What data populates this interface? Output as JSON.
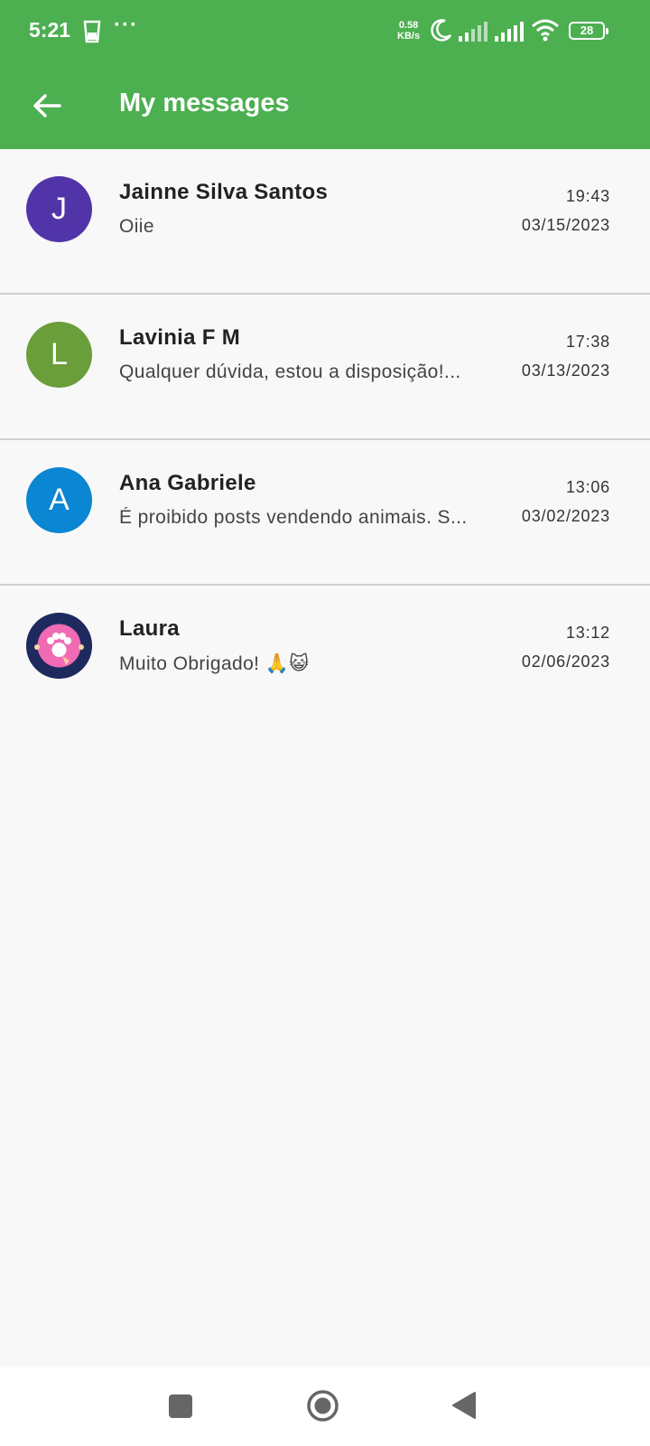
{
  "status_bar": {
    "time": "5:21",
    "more": "···",
    "speed_value": "0.58",
    "speed_unit": "KB/s",
    "battery": "28",
    "icons": [
      "cup-icon",
      "moon-icon",
      "signal-icon",
      "signal-icon",
      "wifi-icon",
      "battery-icon"
    ]
  },
  "app_bar": {
    "title": "My messages",
    "back_icon": "arrow-left-icon",
    "color": "#4caf50"
  },
  "messages": [
    {
      "initial": "J",
      "avatar_color": "#5135a8",
      "name": "Jainne Silva Santos",
      "preview": "Oiie",
      "time": "19:43",
      "date": "03/15/2023"
    },
    {
      "initial": "L",
      "avatar_color": "#6a9e3a",
      "name": "Lavinia F M",
      "preview": "Qualquer dúvida, estou a disposição!...",
      "time": "17:38",
      "date": "03/13/2023"
    },
    {
      "initial": "A",
      "avatar_color": "#0a86d2",
      "name": "Ana Gabriele",
      "preview": "É proibido posts vendendo animais. S...",
      "time": "13:06",
      "date": "03/02/2023"
    },
    {
      "initial": "",
      "avatar_color": "#1e2a5e",
      "avatar_image": "paw-logo-icon",
      "name": "Laura",
      "preview": "Muito Obrigado! 🙏😺",
      "time": "13:12",
      "date": "02/06/2023"
    }
  ],
  "nav_bar": {
    "icons": [
      "recent-apps-icon",
      "home-icon",
      "back-triangle-icon"
    ]
  }
}
